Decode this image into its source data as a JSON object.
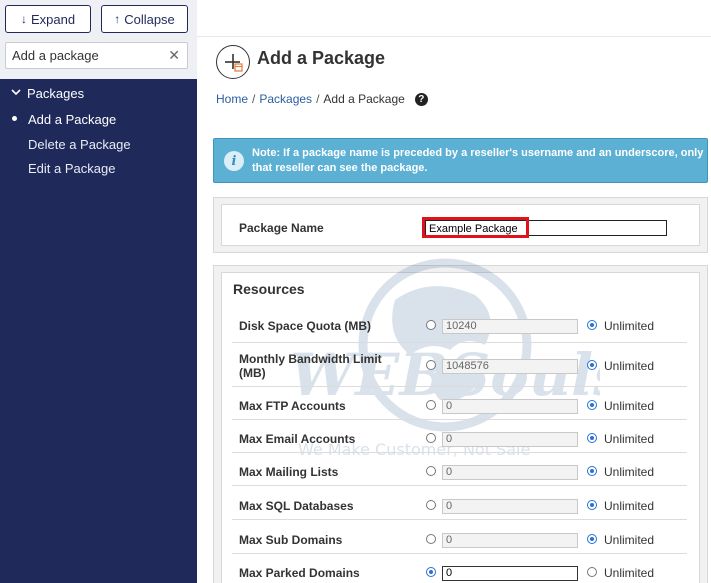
{
  "sidebar": {
    "expand_label": "Expand",
    "collapse_label": "Collapse",
    "search_value": "Add a package",
    "group_label": "Packages",
    "items": [
      {
        "label": "Add a Package",
        "active": true
      },
      {
        "label": "Delete a Package",
        "active": false
      },
      {
        "label": "Edit a Package",
        "active": false
      }
    ]
  },
  "page": {
    "title": "Add a Package",
    "breadcrumb": {
      "home": "Home",
      "packages": "Packages",
      "current": "Add a Package"
    },
    "note": "Note: If a package name is preceded by a reseller's username and an underscore, only that reseller can see the package.",
    "package_name_label": "Package Name",
    "package_name_value": "Example Package",
    "resources_title": "Resources",
    "unlimited_label": "Unlimited",
    "resources": [
      {
        "label": "Disk Space Quota (MB)",
        "value": "10240",
        "unlimited": true
      },
      {
        "label": "Monthly Bandwidth Limit (MB)",
        "value": "1048576",
        "unlimited": true
      },
      {
        "label": "Max FTP Accounts",
        "value": "0",
        "unlimited": true
      },
      {
        "label": "Max Email Accounts",
        "value": "0",
        "unlimited": true
      },
      {
        "label": "Max Mailing Lists",
        "value": "0",
        "unlimited": true
      },
      {
        "label": "Max SQL Databases",
        "value": "0",
        "unlimited": true
      },
      {
        "label": "Max Sub Domains",
        "value": "0",
        "unlimited": true
      },
      {
        "label": "Max Parked Domains",
        "value": "0",
        "unlimited": false
      }
    ]
  },
  "watermark": {
    "brand": "WEBSouls",
    "tagline": "We Make Customer, Not Sale"
  },
  "colors": {
    "sidebar": "#1f2a5a",
    "note": "#5bb0d4",
    "accent": "#2b6fd1",
    "highlight": "#e0121b"
  }
}
